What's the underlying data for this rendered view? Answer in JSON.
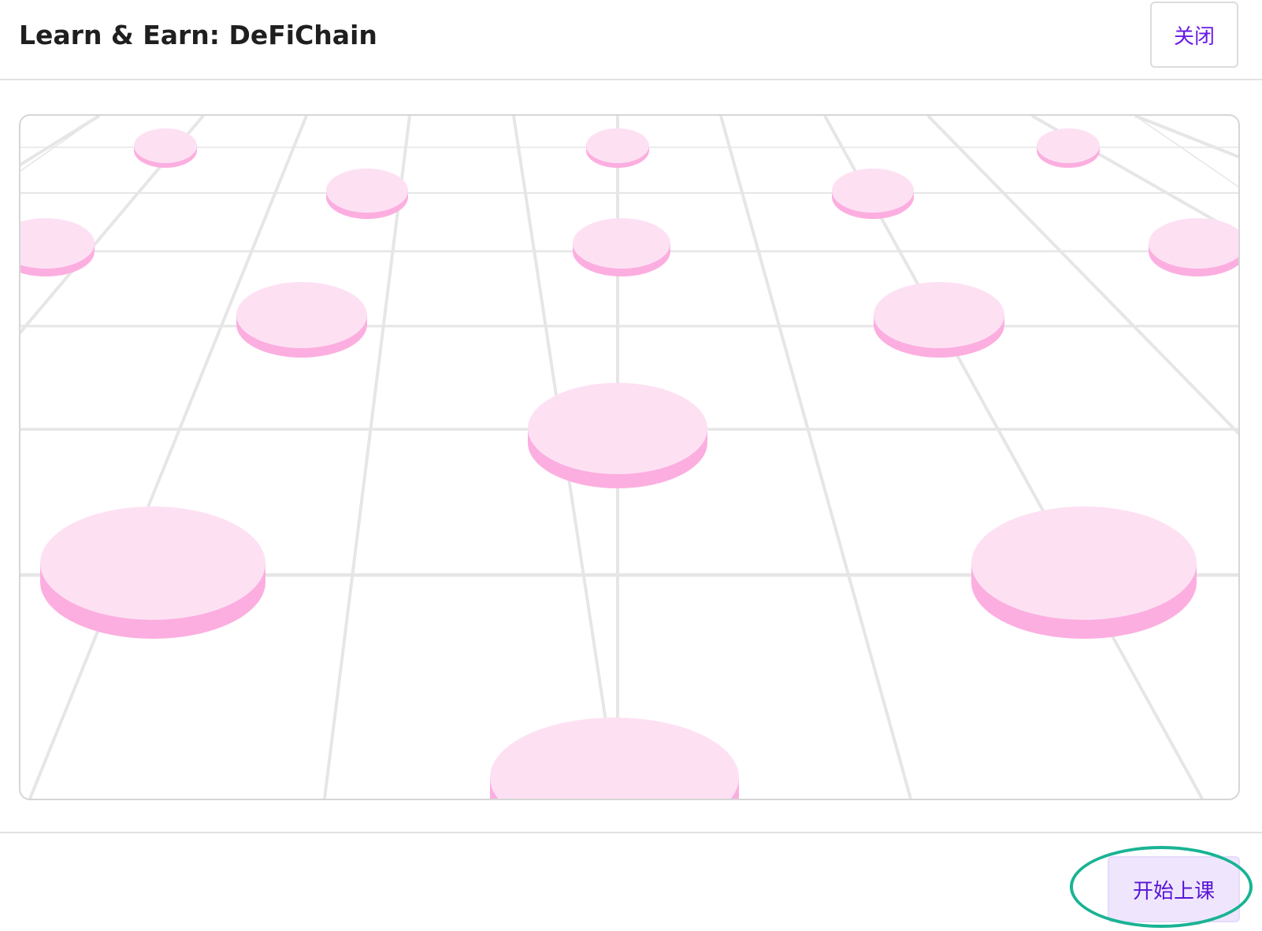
{
  "modal": {
    "title": "Learn & Earn: DeFiChain",
    "close_label": "关闭"
  },
  "illustration": {
    "description_icon": "pink-discs-grid-illustration",
    "colors": {
      "grid_line": "#e6e6e6",
      "disc_top": "#fde1f3",
      "disc_side": "#fcaee0"
    }
  },
  "footer": {
    "start_label": "开始上课"
  },
  "colors": {
    "accent": "#6a19e5",
    "highlight_ring": "#19b394",
    "start_button_bg": "#efe6fd"
  }
}
